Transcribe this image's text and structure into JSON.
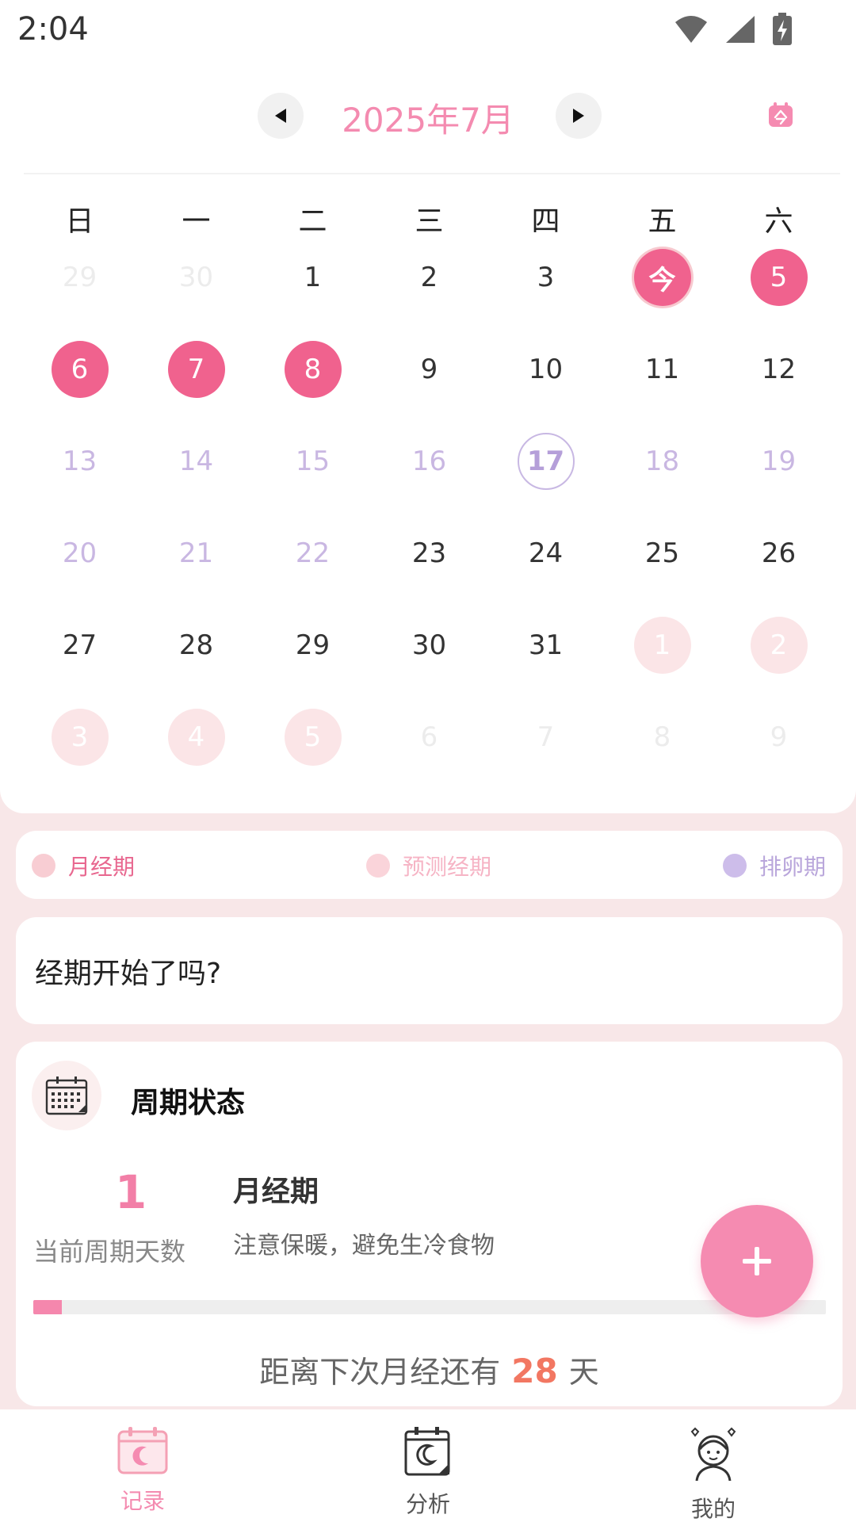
{
  "status_bar": {
    "time": "2:04",
    "icons": [
      "wifi-icon",
      "signal-icon",
      "battery-charging-icon"
    ]
  },
  "calendar": {
    "month_title": "2025年7月",
    "weekdays": [
      "日",
      "一",
      "二",
      "三",
      "四",
      "五",
      "六"
    ],
    "weeks": [
      [
        {
          "label": "29",
          "state": "faded"
        },
        {
          "label": "30",
          "state": "faded"
        },
        {
          "label": "1",
          "state": "normal"
        },
        {
          "label": "2",
          "state": "normal"
        },
        {
          "label": "3",
          "state": "normal"
        },
        {
          "label": "今",
          "state": "today"
        },
        {
          "label": "5",
          "state": "period"
        }
      ],
      [
        {
          "label": "6",
          "state": "period"
        },
        {
          "label": "7",
          "state": "period"
        },
        {
          "label": "8",
          "state": "period"
        },
        {
          "label": "9",
          "state": "normal"
        },
        {
          "label": "10",
          "state": "normal"
        },
        {
          "label": "11",
          "state": "normal"
        },
        {
          "label": "12",
          "state": "normal"
        }
      ],
      [
        {
          "label": "13",
          "state": "fertile"
        },
        {
          "label": "14",
          "state": "fertile"
        },
        {
          "label": "15",
          "state": "fertile"
        },
        {
          "label": "16",
          "state": "fertile"
        },
        {
          "label": "17",
          "state": "ovulation"
        },
        {
          "label": "18",
          "state": "fertile"
        },
        {
          "label": "19",
          "state": "fertile"
        }
      ],
      [
        {
          "label": "20",
          "state": "fertile"
        },
        {
          "label": "21",
          "state": "fertile"
        },
        {
          "label": "22",
          "state": "fertile"
        },
        {
          "label": "23",
          "state": "normal"
        },
        {
          "label": "24",
          "state": "normal"
        },
        {
          "label": "25",
          "state": "normal"
        },
        {
          "label": "26",
          "state": "normal"
        }
      ],
      [
        {
          "label": "27",
          "state": "normal"
        },
        {
          "label": "28",
          "state": "normal"
        },
        {
          "label": "29",
          "state": "normal"
        },
        {
          "label": "30",
          "state": "normal"
        },
        {
          "label": "31",
          "state": "normal"
        },
        {
          "label": "1",
          "state": "predicted"
        },
        {
          "label": "2",
          "state": "predicted"
        }
      ],
      [
        {
          "label": "3",
          "state": "predicted"
        },
        {
          "label": "4",
          "state": "predicted"
        },
        {
          "label": "5",
          "state": "predicted"
        },
        {
          "label": "6",
          "state": "faded"
        },
        {
          "label": "7",
          "state": "faded"
        },
        {
          "label": "8",
          "state": "faded"
        },
        {
          "label": "9",
          "state": "faded"
        }
      ]
    ]
  },
  "legend": {
    "period": {
      "label": "月经期",
      "color": "#F8CDD3",
      "text_color": "#E8678F"
    },
    "predicted": {
      "label": "预测经期",
      "color": "#FAD4DA",
      "text_color": "#F6B4C5"
    },
    "ovulation": {
      "label": "排卵期",
      "color": "#CDBDEA",
      "text_color": "#B9A6DB"
    }
  },
  "question": {
    "text": "经期开始了吗?"
  },
  "cycle_status": {
    "title": "周期状态",
    "current_day": "1",
    "current_day_label": "当前周期天数",
    "phase_name": "月经期",
    "phase_tip": "注意保暖，避免生冷食物",
    "progress_fraction": 0.036,
    "next_prefix": "距离下次月经还有",
    "next_days": "28",
    "next_suffix": "天"
  },
  "fab": {
    "icon": "plus-icon"
  },
  "bottom_nav": [
    {
      "label": "记录",
      "icon": "calendar-moon-icon",
      "active": true
    },
    {
      "label": "分析",
      "icon": "analysis-calendar-icon",
      "active": false
    },
    {
      "label": "我的",
      "icon": "girl-avatar-icon",
      "active": false
    }
  ],
  "colors": {
    "accent": "#F0628E",
    "accent_light": "#F48BB0",
    "fertile_text": "#C9B7E2",
    "background": "#F8E7E8"
  }
}
